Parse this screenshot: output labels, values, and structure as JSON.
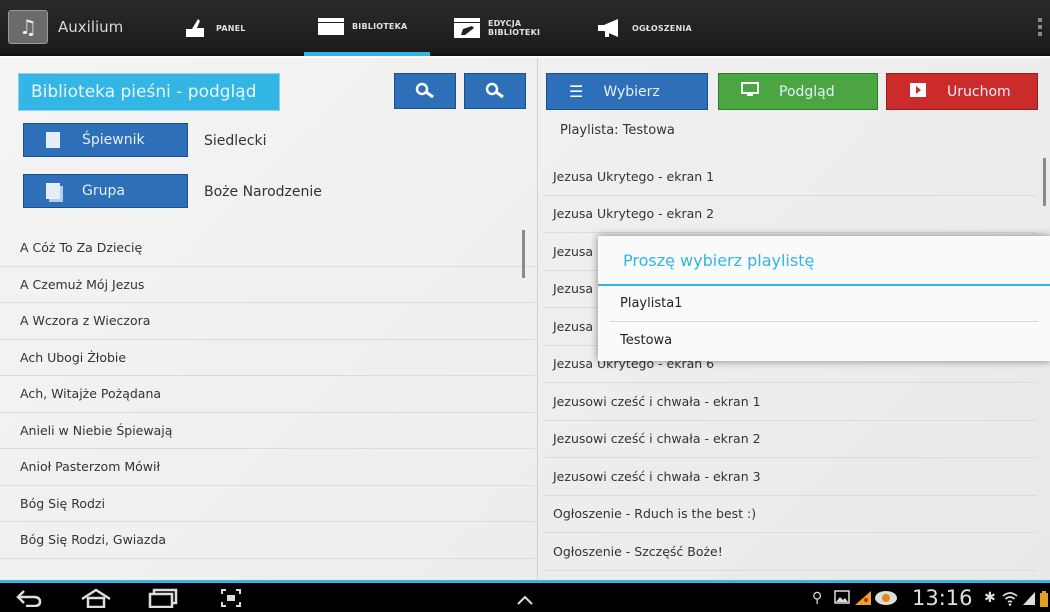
{
  "app": {
    "title": "Auxilium"
  },
  "tabs": [
    {
      "label": "PANEL",
      "icon": "thumb-icon"
    },
    {
      "label": "BIBLIOTEKA",
      "icon": "folder-icon",
      "active": true
    },
    {
      "label": "EDYCJA BIBLIOTEKI",
      "icon": "edit-folder-icon"
    },
    {
      "label": "OGŁOSZENIA",
      "icon": "megaphone-icon"
    }
  ],
  "left": {
    "title": "Biblioteka pieśni - podgląd",
    "spiewnik": {
      "button": "Śpiewnik",
      "value": "Siedlecki"
    },
    "grupa": {
      "button": "Grupa",
      "value": "Boże Narodzenie"
    },
    "songs": [
      "A Cóż To Za Dziecię",
      "A Czemuż Mój Jezus",
      "A Wczora z Wieczora",
      "Ach Ubogi Żłobie",
      "Ach, Witajże Pożądana",
      "Anieli w Niebie Śpiewają",
      "Anioł Pasterzom Mówił",
      "Bóg Się Rodzi",
      "Bóg Się Rodzi, Gwiazda"
    ]
  },
  "right": {
    "buttons": {
      "wybierz": {
        "label": "Wybierz",
        "color": "#2d6fb8"
      },
      "podglad": {
        "label": "Podgląd",
        "color": "#4aa542"
      },
      "uruchom": {
        "label": "Uruchom",
        "color": "#cc2b2b"
      }
    },
    "playlist_label": "Playlista:  Testowa",
    "items": [
      "Jezusa Ukrytego - ekran 1",
      "Jezusa Ukrytego - ekran 2",
      "Jezusa",
      "Jezusa",
      "Jezusa",
      "Jezusa Ukrytego - ekran 6",
      "Jezusowi cześć i chwała - ekran 1",
      "Jezusowi cześć i chwała - ekran 2",
      "Jezusowi cześć i chwała - ekran 3",
      "Ogłoszenie - Rduch is the best :)",
      "Ogłoszenie - Szczęść Boże!"
    ]
  },
  "dialog": {
    "title": "Proszę wybierz playlistę",
    "options": [
      "Playlista1",
      "Testowa"
    ]
  },
  "system": {
    "time": "13:16"
  },
  "colors": {
    "accent": "#33b5e5",
    "blue_button": "#2d6fb8",
    "green_button": "#4aa542",
    "red_button": "#cc2b2b"
  }
}
